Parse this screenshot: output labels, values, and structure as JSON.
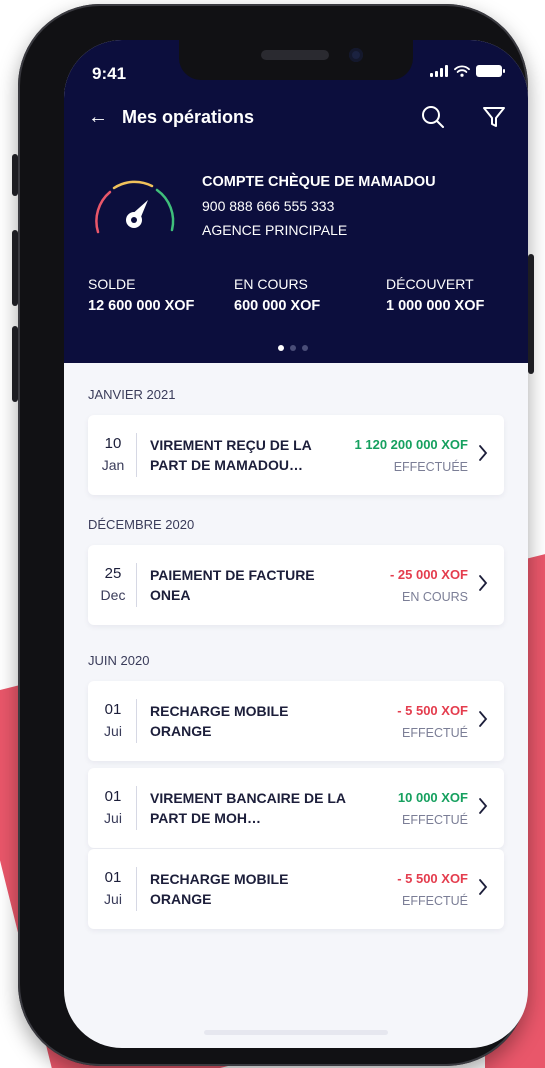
{
  "status_bar": {
    "time": "9:41"
  },
  "nav": {
    "title": "Mes opérations"
  },
  "account": {
    "name": "COMPTE CHÈQUE DE MAMADOU",
    "number": "900 888 666 555 333",
    "branch": "AGENCE PRINCIPALE"
  },
  "stats": [
    {
      "label": "SOLDE",
      "value": "12 600 000 XOF"
    },
    {
      "label": "EN COURS",
      "value": "600 000 XOF"
    },
    {
      "label": "DÉCOUVERT",
      "value": "1 000 000 XOF"
    }
  ],
  "pager": {
    "pages": 3,
    "active": 1
  },
  "sections": [
    {
      "title": "JANVIER 2021"
    },
    {
      "title": "DÉCEMBRE 2020"
    },
    {
      "title": "JUIN 2020"
    }
  ],
  "transactions": [
    {
      "day": "10",
      "month": "Jan",
      "line1": "VIREMENT REÇU DE LA",
      "line2": "PART DE MAMADOU…",
      "amount": "1 120 200 000 XOF",
      "status": "EFFECTUÉE",
      "sign": "credit"
    },
    {
      "day": "25",
      "month": "Dec",
      "line1": "PAIEMENT DE FACTURE",
      "line2": "ONEA",
      "amount": "- 25 000 XOF",
      "status": "EN COURS",
      "sign": "debit"
    },
    {
      "day": "01",
      "month": "Jui",
      "line1": "RECHARGE MOBILE",
      "line2": "ORANGE",
      "amount": "- 5 500 XOF",
      "status": "EFFECTUÉ",
      "sign": "debit"
    },
    {
      "day": "01",
      "month": "Jui",
      "line1": "VIREMENT BANCAIRE DE LA",
      "line2": "PART DE MOH…",
      "amount": "10 000 XOF",
      "status": "EFFECTUÉ",
      "sign": "credit"
    },
    {
      "day": "01",
      "month": "Jui",
      "line1": "RECHARGE MOBILE",
      "line2": "ORANGE",
      "amount": "- 5 500 XOF",
      "status": "EFFECTUÉ",
      "sign": "debit"
    }
  ],
  "colors": {
    "header_bg": "#0c0e3d",
    "credit": "#16a05f",
    "debit": "#e43d4e",
    "accent_red": "#e9576a"
  },
  "icons": {
    "back": "arrow-left-icon",
    "search": "search-icon",
    "filter": "filter-icon",
    "gauge": "gauge-icon",
    "chevron": "chevron-right-icon"
  }
}
